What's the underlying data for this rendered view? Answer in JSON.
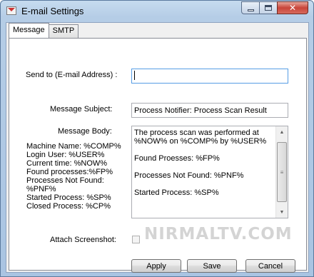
{
  "window": {
    "title": "E-mail Settings"
  },
  "tabs": [
    {
      "label": "Message"
    },
    {
      "label": "SMTP"
    }
  ],
  "form": {
    "send_to_label": "Send to (E-mail Address) :",
    "send_to_value": "",
    "subject_label": "Message Subject:",
    "subject_value": "Process Notifier: Process Scan Result",
    "body_label": "Message Body:",
    "body_paragraphs": [
      "The process scan was performed at %NOW% on %COMP% by %USER%",
      "Found Proesses: %FP%",
      "Processes Not Found: %PNF%",
      "Started Process: %SP%"
    ],
    "variables": [
      "Machine Name: %COMP%",
      "Login User: %USER%",
      "Current time: %NOW%",
      "Found processes:%FP%",
      "Processes Not Found:",
      "%PNF%",
      "Started Process: %SP%",
      "Closed Process: %CP%"
    ],
    "attach_label": "Attach Screenshot:",
    "attach_checked": false
  },
  "buttons": {
    "apply": "Apply",
    "save": "Save",
    "cancel": "Cancel"
  },
  "watermark": "NIRMALTV.COM"
}
